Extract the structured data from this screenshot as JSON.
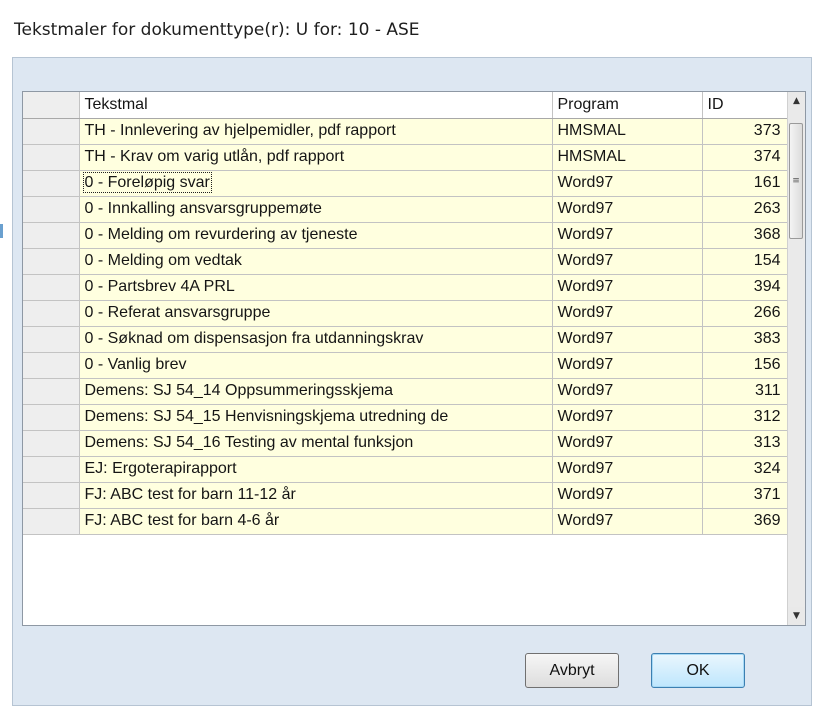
{
  "dialog": {
    "title": "Tekstmaler for dokumenttype(r): U for: 10 - ASE"
  },
  "grid": {
    "columns": {
      "tekstmal": "Tekstmal",
      "program": "Program",
      "id": "ID"
    },
    "rows": [
      {
        "tekstmal": "TH - Innlevering av hjelpemidler, pdf rapport",
        "program": "HMSMAL",
        "id": "373"
      },
      {
        "tekstmal": "TH - Krav om varig utlån, pdf rapport",
        "program": "HMSMAL",
        "id": "374"
      },
      {
        "tekstmal": "0 - Foreløpig svar",
        "program": "Word97",
        "id": "161"
      },
      {
        "tekstmal": "0 - Innkalling ansvarsgruppemøte",
        "program": "Word97",
        "id": "263"
      },
      {
        "tekstmal": "0 - Melding om revurdering av tjeneste",
        "program": "Word97",
        "id": "368"
      },
      {
        "tekstmal": "0 - Melding om vedtak",
        "program": "Word97",
        "id": "154"
      },
      {
        "tekstmal": "0 - Partsbrev 4A PRL",
        "program": "Word97",
        "id": "394"
      },
      {
        "tekstmal": "0 - Referat ansvarsgruppe",
        "program": "Word97",
        "id": "266"
      },
      {
        "tekstmal": "0 - Søknad om dispensasjon fra utdanningskrav",
        "program": "Word97",
        "id": "383"
      },
      {
        "tekstmal": "0 - Vanlig brev",
        "program": "Word97",
        "id": "156"
      },
      {
        "tekstmal": "Demens: SJ 54_14 Oppsummeringsskjema",
        "program": "Word97",
        "id": "311"
      },
      {
        "tekstmal": "Demens: SJ 54_15 Henvisningskjema utredning de",
        "program": "Word97",
        "id": "312"
      },
      {
        "tekstmal": "Demens: SJ 54_16 Testing av mental funksjon",
        "program": "Word97",
        "id": "313"
      },
      {
        "tekstmal": "EJ: Ergoterapirapport",
        "program": "Word97",
        "id": "324"
      },
      {
        "tekstmal": "FJ: ABC test for barn 11-12 år",
        "program": "Word97",
        "id": "371"
      },
      {
        "tekstmal": "FJ: ABC test for barn 4-6 år",
        "program": "Word97",
        "id": "369"
      }
    ],
    "selected_row": 2
  },
  "buttons": {
    "cancel": "Avbryt",
    "ok": "OK"
  },
  "icons": {
    "scroll_up": "scroll-up-arrow-icon",
    "scroll_down": "scroll-down-arrow-icon",
    "grip": "scrollbar-grip-icon"
  }
}
